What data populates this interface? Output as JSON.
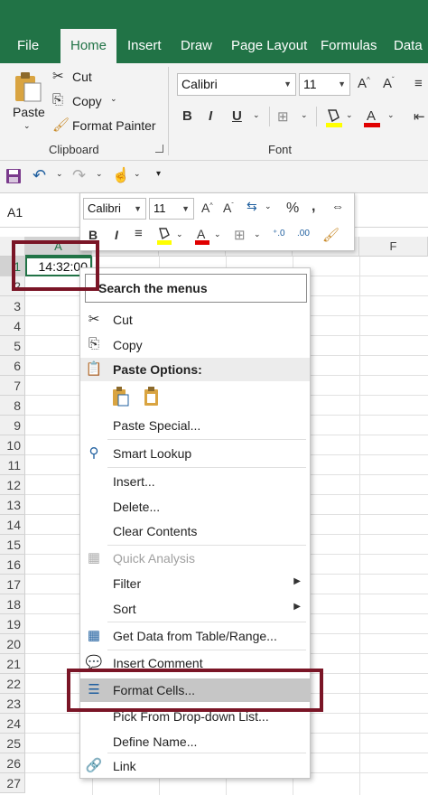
{
  "tabs": [
    "File",
    "Home",
    "Insert",
    "Draw",
    "Page Layout",
    "Formulas",
    "Data"
  ],
  "ribbon": {
    "paste_label": "Paste",
    "cut_label": "Cut",
    "copy_label": "Copy",
    "format_painter_label": "Format Painter",
    "clipboard_group": "Clipboard",
    "font_name": "Calibri",
    "font_size": "11",
    "font_group": "Font",
    "bold": "B",
    "italic": "I",
    "underline": "U"
  },
  "name_box": "A1",
  "columns": [
    "A",
    "F"
  ],
  "rows": [
    "1",
    "2",
    "3",
    "4",
    "5",
    "6",
    "7",
    "8",
    "9",
    "10",
    "11",
    "12",
    "13",
    "14",
    "15",
    "16",
    "17",
    "18",
    "19",
    "20",
    "21",
    "22",
    "23",
    "24",
    "25",
    "26",
    "27"
  ],
  "cell_a1": "14:32:00",
  "mini_toolbar": {
    "font_name": "Calibri",
    "font_size": "11",
    "bold": "B",
    "italic": "I",
    "percent": "%",
    "comma": ","
  },
  "context_menu": {
    "search_placeholder": "Search the menus",
    "cut": "Cut",
    "copy": "Copy",
    "paste_options": "Paste Options:",
    "paste_special": "Paste Special...",
    "smart_lookup": "Smart Lookup",
    "insert": "Insert...",
    "delete": "Delete...",
    "clear_contents": "Clear Contents",
    "quick_analysis": "Quick Analysis",
    "filter": "Filter",
    "sort": "Sort",
    "get_data": "Get Data from Table/Range...",
    "insert_comment": "Insert Comment",
    "format_cells": "Format Cells...",
    "pick_list": "Pick From Drop-down List...",
    "define_name": "Define Name...",
    "link": "Link"
  },
  "colors": {
    "excel_green": "#217346",
    "annotation_red": "#7a1526",
    "highlight_gray": "#c6c6c6"
  }
}
